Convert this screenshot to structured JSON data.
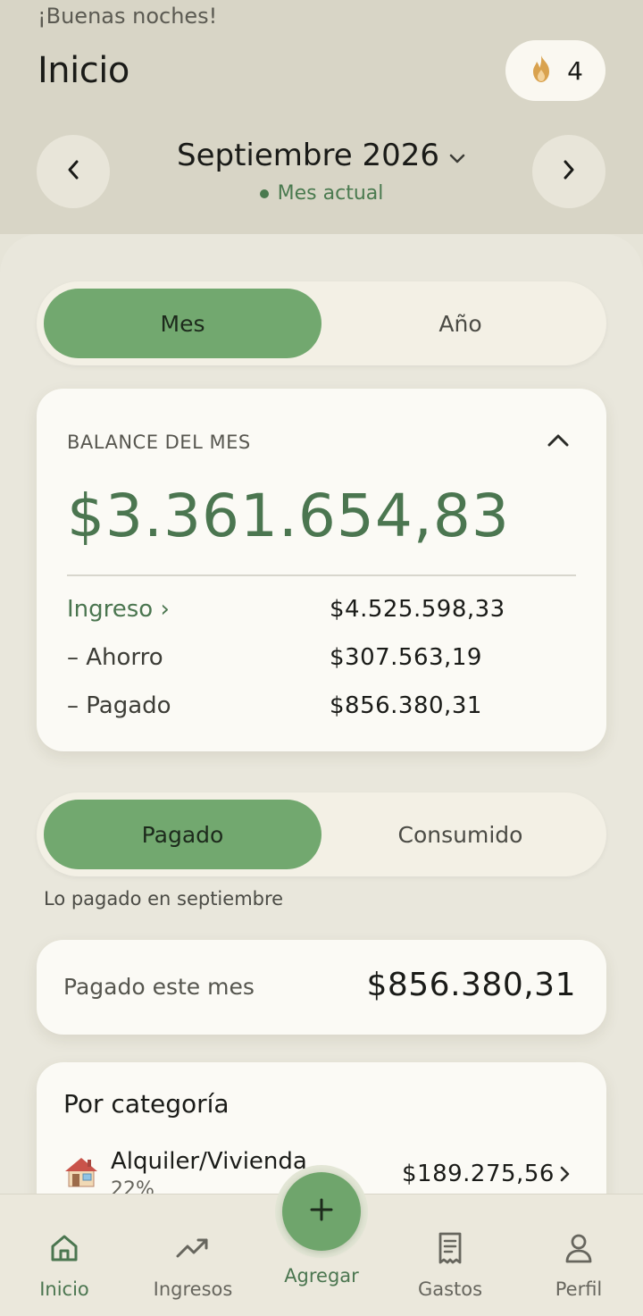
{
  "header": {
    "greeting": "¡Buenas noches!",
    "title": "Inicio",
    "streak_count": "4",
    "month": "Septiembre 2026",
    "month_status": "Mes actual"
  },
  "period_toggle": {
    "month": "Mes",
    "year": "Año",
    "selected": "Mes"
  },
  "balance": {
    "label": "BALANCE DEL MES",
    "amount": "$3.361.654,83",
    "rows": [
      {
        "label": "Ingreso ›",
        "value": "$4.525.598,33"
      },
      {
        "label": "– Ahorro",
        "value": "$307.563,19"
      },
      {
        "label": "– Pagado",
        "value": "$856.380,31"
      }
    ]
  },
  "paid_toggle": {
    "paid": "Pagado",
    "consumed": "Consumido",
    "selected": "Pagado"
  },
  "paid_caption": "Lo pagado en septiembre",
  "paid_summary": {
    "label": "Pagado este mes",
    "value": "$856.380,31"
  },
  "categories": {
    "title": "Por categoría",
    "items": [
      {
        "icon": "house-icon",
        "name": "Alquiler/Vivienda",
        "percent": "22%",
        "amount": "$189.275,56"
      }
    ]
  },
  "bottom_nav": {
    "items": [
      {
        "label": "Inicio",
        "icon": "home-icon",
        "active": true
      },
      {
        "label": "Ingresos",
        "icon": "trending-up-icon",
        "active": false
      },
      {
        "label": "Agregar",
        "icon": "plus-icon",
        "active": false
      },
      {
        "label": "Gastos",
        "icon": "receipt-icon",
        "active": false
      },
      {
        "label": "Perfil",
        "icon": "user-icon",
        "active": false
      }
    ]
  },
  "colors": {
    "accent": "#72a86f",
    "accent_text": "#4b7650",
    "background": "#e9e7dc",
    "card": "#fbfaf5",
    "streak_flame": "#d9a24e"
  }
}
